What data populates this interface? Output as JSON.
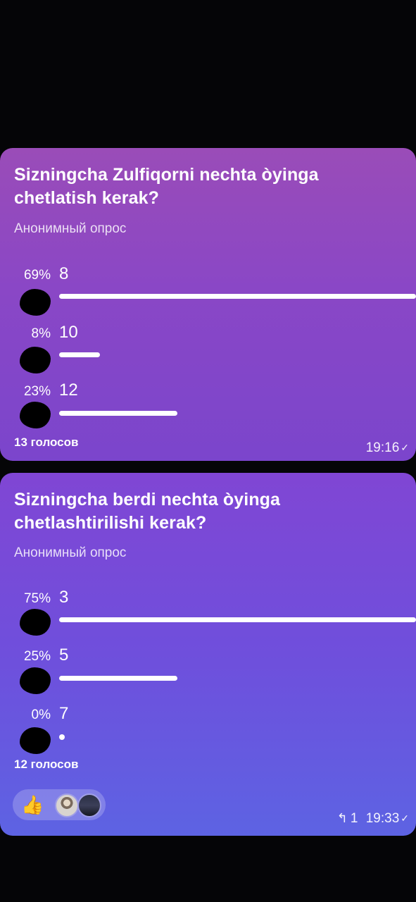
{
  "polls": [
    {
      "question": "Sizningcha Zulfiqorni nechta òyinga chetlatish kerak?",
      "type": "Анонимный опрос",
      "options": [
        {
          "percent": "69%",
          "label": "8",
          "fraction": 0.69
        },
        {
          "percent": "8%",
          "label": "10",
          "fraction": 0.08
        },
        {
          "percent": "23%",
          "label": "12",
          "fraction": 0.23
        }
      ],
      "votes": "13 голосов",
      "time": "19:16"
    },
    {
      "question": "Sizningcha berdi nechta òyinga chetlashtirilishi kerak?",
      "type": "Анонимный опрос",
      "options": [
        {
          "percent": "75%",
          "label": "3",
          "fraction": 0.75
        },
        {
          "percent": "25%",
          "label": "5",
          "fraction": 0.25
        },
        {
          "percent": "0%",
          "label": "7",
          "fraction": 0.0
        }
      ],
      "votes": "12 голосов",
      "time": "19:33",
      "reactions": {
        "emoji": "👍",
        "avatars": [
          "avatar-1",
          "avatar-2"
        ]
      },
      "reply_count": "1"
    }
  ],
  "icons": {
    "checkmark": "check-icon",
    "reply": "reply-arrow-icon"
  }
}
